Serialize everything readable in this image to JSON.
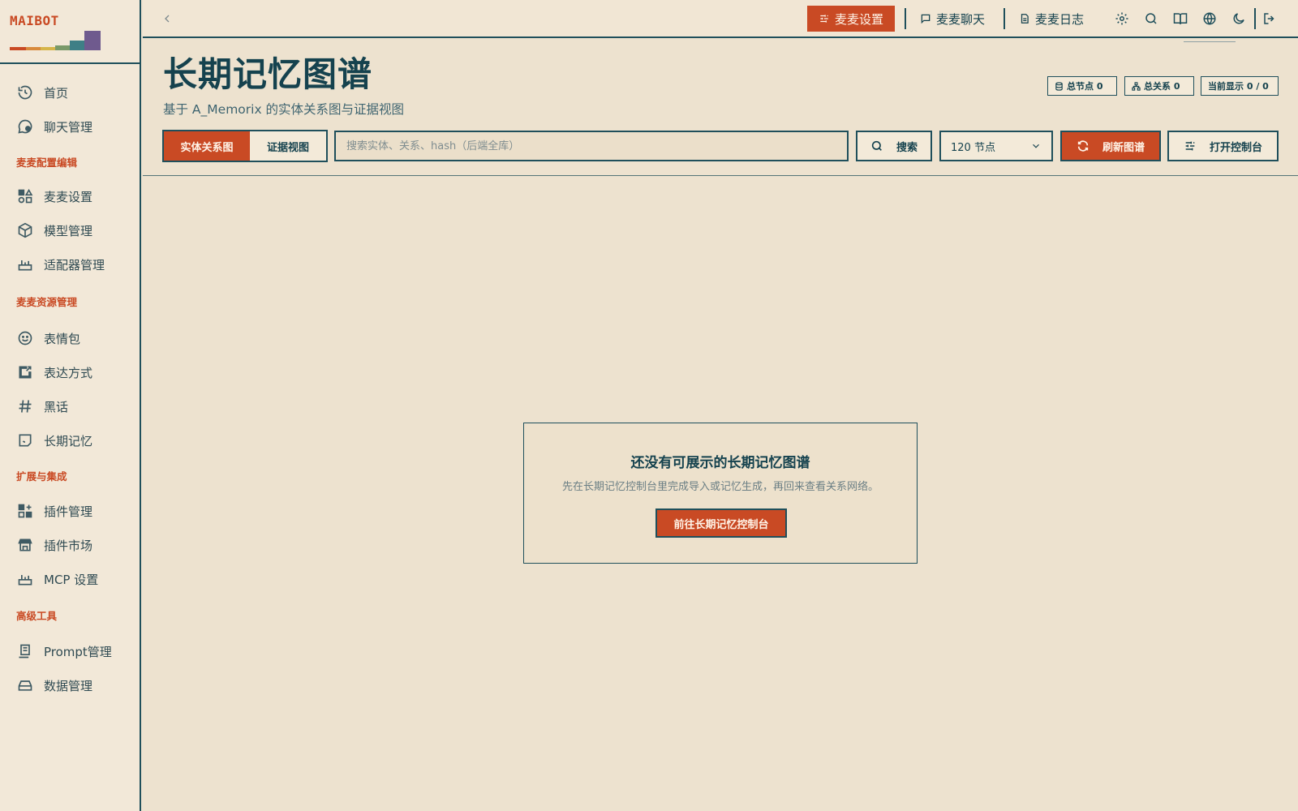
{
  "brand": {
    "name": "MAIBOT",
    "accent": "#c94a24",
    "ink": "#15424e"
  },
  "sidebar": {
    "items": [
      {
        "label": "首页",
        "icon": "history-icon"
      },
      {
        "label": "聊天管理",
        "icon": "chat-icon"
      },
      {
        "label": "麦麦设置",
        "icon": "shapes-icon"
      },
      {
        "label": "模型管理",
        "icon": "cube-icon"
      },
      {
        "label": "适配器管理",
        "icon": "router-icon"
      },
      {
        "label": "表情包",
        "icon": "smile-icon"
      },
      {
        "label": "表达方式",
        "icon": "edit-note-icon"
      },
      {
        "label": "黑话",
        "icon": "hash-icon"
      },
      {
        "label": "长期记忆",
        "icon": "memory-icon"
      },
      {
        "label": "插件管理",
        "icon": "grid-plus-icon"
      },
      {
        "label": "插件市场",
        "icon": "store-icon"
      },
      {
        "label": "MCP 设置",
        "icon": "router-icon"
      },
      {
        "label": "Prompt管理",
        "icon": "document-icon"
      },
      {
        "label": "数据管理",
        "icon": "hard-drive-icon"
      }
    ],
    "groups": [
      "麦麦配置编辑",
      "麦麦资源管理",
      "扩展与集成",
      "高级工具"
    ]
  },
  "topbar": {
    "tabs": [
      {
        "label": "麦麦设置",
        "icon": "sliders-icon",
        "active": true
      },
      {
        "label": "麦麦聊天",
        "icon": "message-icon",
        "active": false
      },
      {
        "label": "麦麦日志",
        "icon": "file-icon",
        "active": false
      }
    ],
    "icons": [
      "settings-icon",
      "search-icon",
      "book-icon",
      "globe-icon",
      "moon-icon",
      "logout-icon"
    ]
  },
  "header": {
    "title": "长期记忆图谱",
    "subtitle": "基于 A_Memorix 的实体关系图与证据视图"
  },
  "stats": {
    "total_nodes": "总节点 0",
    "total_relations": "总关系 0",
    "current_display": "当前显示 0 / 0"
  },
  "toolbar": {
    "view_tabs": [
      {
        "label": "实体关系图",
        "active": true
      },
      {
        "label": "证据视图",
        "active": false
      }
    ],
    "search_placeholder": "搜索实体、关系、hash（后端全库）",
    "search_value": "",
    "search_label": "搜索",
    "node_limit": "120 节点",
    "refresh_label": "刷新图谱",
    "console_label": "打开控制台"
  },
  "empty_state": {
    "title": "还没有可展示的长期记忆图谱",
    "description": "先在长期记忆控制台里完成导入或记忆生成，再回来查看关系网络。",
    "action_label": "前往长期记忆控制台"
  }
}
